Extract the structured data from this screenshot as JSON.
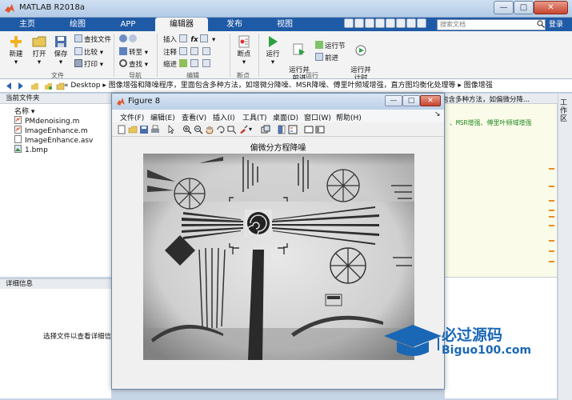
{
  "window": {
    "title": "MATLAB R2018a",
    "min": "—",
    "max": "□",
    "close": "✕"
  },
  "tabs": [
    "主页",
    "绘图",
    "APP",
    "编辑器",
    "发布",
    "视图"
  ],
  "search": {
    "placeholder": "搜索文档"
  },
  "login": "登录",
  "ribbon": {
    "file": {
      "new": "新建",
      "open": "打开",
      "save": "保存",
      "find_files": "查找文件",
      "compare": "比较",
      "print": "打印",
      "label": "文件"
    },
    "nav": {
      "goto": "转至",
      "find": "查找",
      "label": "导航"
    },
    "edit": {
      "insert": "插入",
      "comment": "注释",
      "indent": "缩进",
      "label": "编辑"
    },
    "breakpoints": {
      "breakpoint": "断点",
      "label": "断点"
    },
    "run": {
      "run": "运行",
      "run_advance": "运行并\n前进",
      "run_section": "运行节",
      "advance": "前进",
      "run_time": "运行并\n计时",
      "label": "运行"
    }
  },
  "address": {
    "crumbs": "« Desktop ▸ 图像增强和降噪程序，里面包含多种方法，如增微分降噪、MSR降噪、傅里叶频域增强，直方图均衡化处理等 ▸ 图像增强"
  },
  "current_folder": {
    "header": "当前文件夹",
    "col_name": "名称 ▾",
    "files": [
      "PMdenoising.m",
      "ImageEnhance.m",
      "ImageEnhance.asv",
      "1.bmp"
    ]
  },
  "details": {
    "header": "详细信息",
    "message": "选择文件以查看详细信息"
  },
  "editor": {
    "tab_text": "包含多种方法，如偏微分降...",
    "code": "、MSR增强、傅里叶频域增强"
  },
  "workspace": {
    "label": "工作区"
  },
  "figure": {
    "title": "Figure 8",
    "menu": [
      "文件(F)",
      "编辑(E)",
      "查看(V)",
      "插入(I)",
      "工具(T)",
      "桌面(D)",
      "窗口(W)",
      "帮助(H)"
    ],
    "plot_title": "偏微分方程降噪"
  },
  "watermark": {
    "text": "必过源码",
    "url": "Biguo100.com"
  },
  "colors": {
    "ribbon_blue": "#1f5aa6",
    "accent_orange": "#f08a22",
    "watermark_blue": "#1a67b5"
  }
}
